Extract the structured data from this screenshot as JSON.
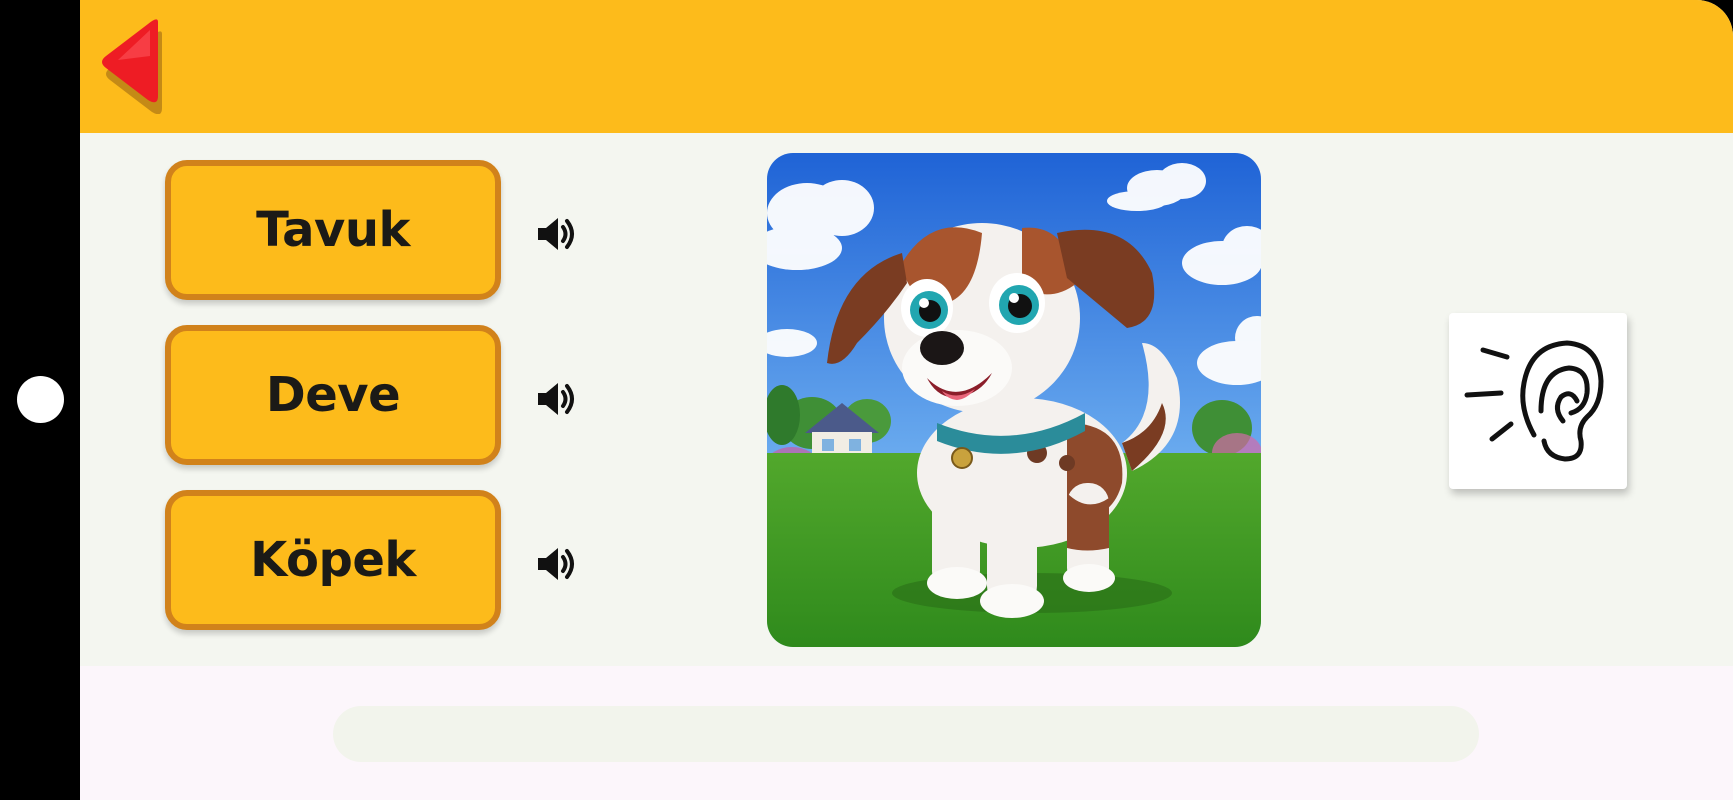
{
  "header": {
    "back_icon": "back-triangle-icon",
    "accent": "#fdbb1b"
  },
  "options": [
    {
      "label": "Tavuk",
      "speaker_icon": "speaker-icon"
    },
    {
      "label": "Deve",
      "speaker_icon": "speaker-icon"
    },
    {
      "label": "Köpek",
      "speaker_icon": "speaker-icon"
    }
  ],
  "picture": {
    "subject_icon": "cartoon-dog-illustration"
  },
  "listen": {
    "icon": "ear-icon"
  },
  "progress": {
    "value": 0
  },
  "colors": {
    "button_fill": "#fdbb1b",
    "button_border": "#d1821b",
    "back_arrow": "#ee1c24"
  }
}
